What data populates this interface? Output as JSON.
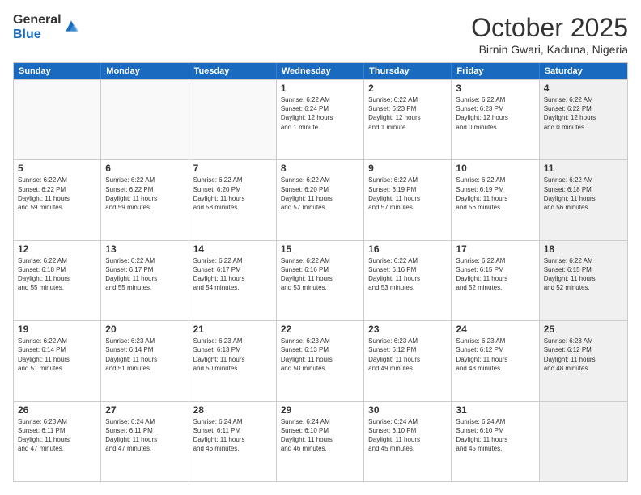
{
  "logo": {
    "general": "General",
    "blue": "Blue"
  },
  "header": {
    "month": "October 2025",
    "location": "Birnin Gwari, Kaduna, Nigeria"
  },
  "days": [
    "Sunday",
    "Monday",
    "Tuesday",
    "Wednesday",
    "Thursday",
    "Friday",
    "Saturday"
  ],
  "rows": [
    [
      {
        "day": "",
        "empty": true
      },
      {
        "day": "",
        "empty": true
      },
      {
        "day": "",
        "empty": true
      },
      {
        "day": "1",
        "lines": [
          "Sunrise: 6:22 AM",
          "Sunset: 6:24 PM",
          "Daylight: 12 hours",
          "and 1 minute."
        ]
      },
      {
        "day": "2",
        "lines": [
          "Sunrise: 6:22 AM",
          "Sunset: 6:23 PM",
          "Daylight: 12 hours",
          "and 1 minute."
        ]
      },
      {
        "day": "3",
        "lines": [
          "Sunrise: 6:22 AM",
          "Sunset: 6:23 PM",
          "Daylight: 12 hours",
          "and 0 minutes."
        ]
      },
      {
        "day": "4",
        "lines": [
          "Sunrise: 6:22 AM",
          "Sunset: 6:22 PM",
          "Daylight: 12 hours",
          "and 0 minutes."
        ],
        "shaded": true
      }
    ],
    [
      {
        "day": "5",
        "lines": [
          "Sunrise: 6:22 AM",
          "Sunset: 6:22 PM",
          "Daylight: 11 hours",
          "and 59 minutes."
        ]
      },
      {
        "day": "6",
        "lines": [
          "Sunrise: 6:22 AM",
          "Sunset: 6:22 PM",
          "Daylight: 11 hours",
          "and 59 minutes."
        ]
      },
      {
        "day": "7",
        "lines": [
          "Sunrise: 6:22 AM",
          "Sunset: 6:20 PM",
          "Daylight: 11 hours",
          "and 58 minutes."
        ]
      },
      {
        "day": "8",
        "lines": [
          "Sunrise: 6:22 AM",
          "Sunset: 6:20 PM",
          "Daylight: 11 hours",
          "and 57 minutes."
        ]
      },
      {
        "day": "9",
        "lines": [
          "Sunrise: 6:22 AM",
          "Sunset: 6:19 PM",
          "Daylight: 11 hours",
          "and 57 minutes."
        ]
      },
      {
        "day": "10",
        "lines": [
          "Sunrise: 6:22 AM",
          "Sunset: 6:19 PM",
          "Daylight: 11 hours",
          "and 56 minutes."
        ]
      },
      {
        "day": "11",
        "lines": [
          "Sunrise: 6:22 AM",
          "Sunset: 6:18 PM",
          "Daylight: 11 hours",
          "and 56 minutes."
        ],
        "shaded": true
      }
    ],
    [
      {
        "day": "12",
        "lines": [
          "Sunrise: 6:22 AM",
          "Sunset: 6:18 PM",
          "Daylight: 11 hours",
          "and 55 minutes."
        ]
      },
      {
        "day": "13",
        "lines": [
          "Sunrise: 6:22 AM",
          "Sunset: 6:17 PM",
          "Daylight: 11 hours",
          "and 55 minutes."
        ]
      },
      {
        "day": "14",
        "lines": [
          "Sunrise: 6:22 AM",
          "Sunset: 6:17 PM",
          "Daylight: 11 hours",
          "and 54 minutes."
        ]
      },
      {
        "day": "15",
        "lines": [
          "Sunrise: 6:22 AM",
          "Sunset: 6:16 PM",
          "Daylight: 11 hours",
          "and 53 minutes."
        ]
      },
      {
        "day": "16",
        "lines": [
          "Sunrise: 6:22 AM",
          "Sunset: 6:16 PM",
          "Daylight: 11 hours",
          "and 53 minutes."
        ]
      },
      {
        "day": "17",
        "lines": [
          "Sunrise: 6:22 AM",
          "Sunset: 6:15 PM",
          "Daylight: 11 hours",
          "and 52 minutes."
        ]
      },
      {
        "day": "18",
        "lines": [
          "Sunrise: 6:22 AM",
          "Sunset: 6:15 PM",
          "Daylight: 11 hours",
          "and 52 minutes."
        ],
        "shaded": true
      }
    ],
    [
      {
        "day": "19",
        "lines": [
          "Sunrise: 6:22 AM",
          "Sunset: 6:14 PM",
          "Daylight: 11 hours",
          "and 51 minutes."
        ]
      },
      {
        "day": "20",
        "lines": [
          "Sunrise: 6:23 AM",
          "Sunset: 6:14 PM",
          "Daylight: 11 hours",
          "and 51 minutes."
        ]
      },
      {
        "day": "21",
        "lines": [
          "Sunrise: 6:23 AM",
          "Sunset: 6:13 PM",
          "Daylight: 11 hours",
          "and 50 minutes."
        ]
      },
      {
        "day": "22",
        "lines": [
          "Sunrise: 6:23 AM",
          "Sunset: 6:13 PM",
          "Daylight: 11 hours",
          "and 50 minutes."
        ]
      },
      {
        "day": "23",
        "lines": [
          "Sunrise: 6:23 AM",
          "Sunset: 6:12 PM",
          "Daylight: 11 hours",
          "and 49 minutes."
        ]
      },
      {
        "day": "24",
        "lines": [
          "Sunrise: 6:23 AM",
          "Sunset: 6:12 PM",
          "Daylight: 11 hours",
          "and 48 minutes."
        ]
      },
      {
        "day": "25",
        "lines": [
          "Sunrise: 6:23 AM",
          "Sunset: 6:12 PM",
          "Daylight: 11 hours",
          "and 48 minutes."
        ],
        "shaded": true
      }
    ],
    [
      {
        "day": "26",
        "lines": [
          "Sunrise: 6:23 AM",
          "Sunset: 6:11 PM",
          "Daylight: 11 hours",
          "and 47 minutes."
        ]
      },
      {
        "day": "27",
        "lines": [
          "Sunrise: 6:24 AM",
          "Sunset: 6:11 PM",
          "Daylight: 11 hours",
          "and 47 minutes."
        ]
      },
      {
        "day": "28",
        "lines": [
          "Sunrise: 6:24 AM",
          "Sunset: 6:11 PM",
          "Daylight: 11 hours",
          "and 46 minutes."
        ]
      },
      {
        "day": "29",
        "lines": [
          "Sunrise: 6:24 AM",
          "Sunset: 6:10 PM",
          "Daylight: 11 hours",
          "and 46 minutes."
        ]
      },
      {
        "day": "30",
        "lines": [
          "Sunrise: 6:24 AM",
          "Sunset: 6:10 PM",
          "Daylight: 11 hours",
          "and 45 minutes."
        ]
      },
      {
        "day": "31",
        "lines": [
          "Sunrise: 6:24 AM",
          "Sunset: 6:10 PM",
          "Daylight: 11 hours",
          "and 45 minutes."
        ]
      },
      {
        "day": "",
        "empty": true,
        "shaded": true
      }
    ]
  ]
}
